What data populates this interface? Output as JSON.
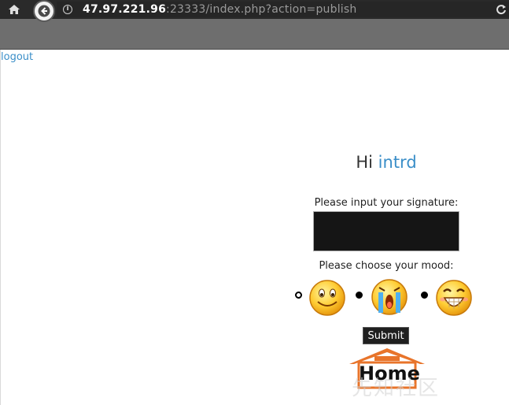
{
  "browser": {
    "url_host": "47.97.221.96",
    "url_rest": ":23333/index.php?action=publish"
  },
  "page": {
    "logout_label": "logout",
    "greeting_prefix": "Hi",
    "username": "intrd",
    "signature_label": "Please input your signature:",
    "signature_value": "",
    "mood_label": "Please choose your mood:",
    "moods": [
      {
        "icon": "smile-emoji-icon",
        "selected": true
      },
      {
        "icon": "crying-emoji-icon",
        "selected": false
      },
      {
        "icon": "grin-emoji-icon",
        "selected": false
      }
    ],
    "submit_label": "Submit",
    "home_logo_text": "Home",
    "watermark_text": "先知社区"
  },
  "colors": {
    "link": "#3a8ec8",
    "signature_bg": "#151515",
    "submit_bg": "#1f1f1f",
    "home_roof": "#e8742a"
  }
}
